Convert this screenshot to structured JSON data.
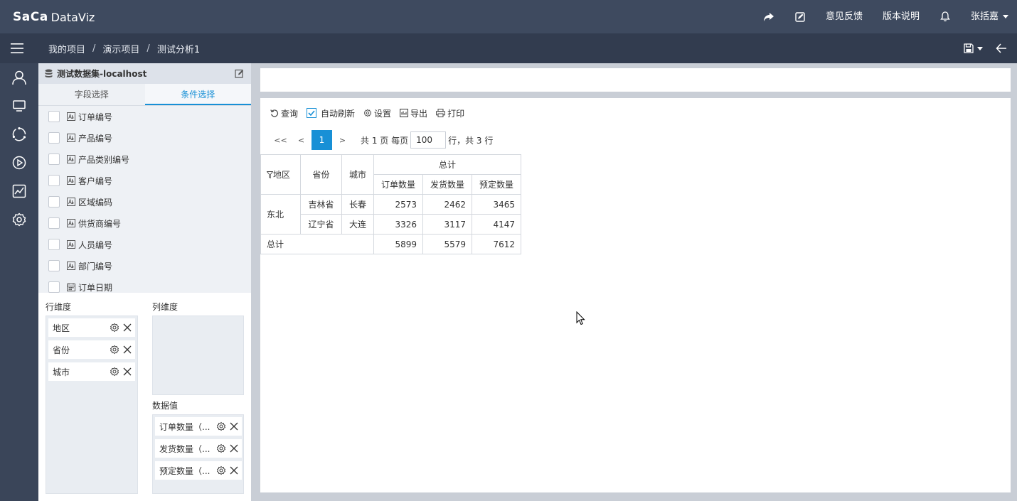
{
  "app": {
    "brand": "SaCa",
    "product": "DataViz"
  },
  "topbar": {
    "feedback": "意见反馈",
    "release_notes": "版本说明",
    "user": "张括嘉"
  },
  "breadcrumb": [
    "我的项目",
    "演示项目",
    "测试分析1"
  ],
  "breadcrumb_sep": "/",
  "dataset": {
    "title": "测试数据集-localhost"
  },
  "tabs": {
    "fields": "字段选择",
    "conditions": "条件选择"
  },
  "fields": [
    {
      "label": "订单编号",
      "type": "text"
    },
    {
      "label": "产品编号",
      "type": "text"
    },
    {
      "label": "产品类别编号",
      "type": "text"
    },
    {
      "label": "客户编号",
      "type": "text"
    },
    {
      "label": "区域编码",
      "type": "text"
    },
    {
      "label": "供货商编号",
      "type": "text"
    },
    {
      "label": "人员编号",
      "type": "text"
    },
    {
      "label": "部门编号",
      "type": "text"
    },
    {
      "label": "订单日期",
      "type": "date"
    }
  ],
  "dims": {
    "row_label": "行维度",
    "col_label": "列维度",
    "values_label": "数据值",
    "rows": [
      "地区",
      "省份",
      "城市"
    ],
    "values": [
      "订单数量（...",
      "发货数量（...",
      "预定数量（..."
    ]
  },
  "toolbar": {
    "query": "查询",
    "auto_refresh": "自动刷新",
    "settings": "设置",
    "export": "导出",
    "print": "打印"
  },
  "pager": {
    "first": "<<",
    "prev": "<",
    "current": "1",
    "next": ">",
    "summary_pre": "共 1 页 每页",
    "page_size": "100",
    "summary_post": "行，共 3 行"
  },
  "table": {
    "headers": {
      "region": "地区",
      "province": "省份",
      "city": "城市",
      "total": "总计",
      "m1": "订单数量",
      "m2": "发货数量",
      "m3": "预定数量"
    },
    "region": "东北",
    "rows": [
      {
        "province": "吉林省",
        "city": "长春",
        "m1": "2573",
        "m2": "2462",
        "m3": "3465"
      },
      {
        "province": "辽宁省",
        "city": "大连",
        "m1": "3326",
        "m2": "3117",
        "m3": "4147"
      }
    ],
    "total_row": {
      "label": "总计",
      "m1": "5899",
      "m2": "5579",
      "m3": "7612"
    }
  },
  "colors": {
    "topbar": "#3e4a5f",
    "subbar": "#323c4f",
    "rail": "#3a4559",
    "accent": "#1890d6"
  },
  "icons": {
    "topbar": [
      "share-icon",
      "edit-icon",
      "bell-icon"
    ],
    "rail": [
      "user-icon",
      "monitor-icon",
      "refresh-circle-icon",
      "play-icon",
      "chart-icon",
      "gear-icon"
    ]
  }
}
